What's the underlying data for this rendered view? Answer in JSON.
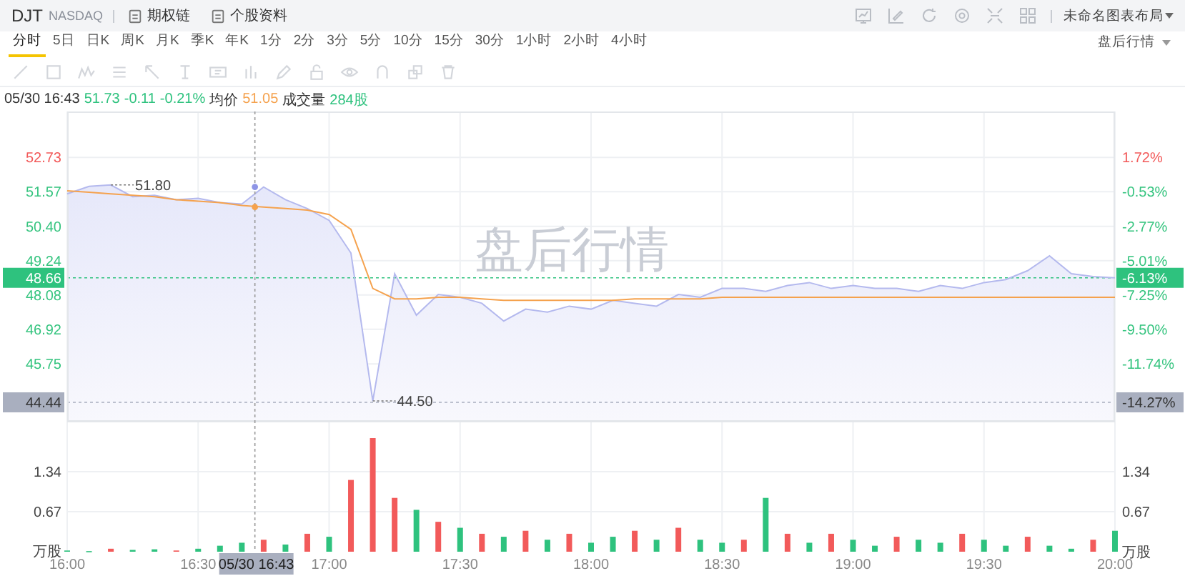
{
  "header": {
    "symbol": "DJT",
    "exchange": "NASDAQ",
    "links": [
      {
        "label": "期权链"
      },
      {
        "label": "个股资料"
      }
    ],
    "layout_menu": "未命名图表布局"
  },
  "periods": [
    {
      "label": "分时",
      "selected": true
    },
    {
      "label": "5日",
      "selected": false
    },
    {
      "label": "日K",
      "selected": false
    },
    {
      "label": "周K",
      "selected": false
    },
    {
      "label": "月K",
      "selected": false
    },
    {
      "label": "季K",
      "selected": false
    },
    {
      "label": "年K",
      "selected": false
    },
    {
      "label": "1分",
      "selected": false
    },
    {
      "label": "2分",
      "selected": false
    },
    {
      "label": "3分",
      "selected": false
    },
    {
      "label": "5分",
      "selected": false
    },
    {
      "label": "10分",
      "selected": false
    },
    {
      "label": "15分",
      "selected": false
    },
    {
      "label": "30分",
      "selected": false
    },
    {
      "label": "1小时",
      "selected": false
    },
    {
      "label": "2小时",
      "selected": false
    },
    {
      "label": "4小时",
      "selected": false
    }
  ],
  "session_menu": "盘后行情",
  "quote": {
    "time": "05/30 16:43",
    "price": "51.73",
    "change": "-0.11",
    "change_pct": "-0.21%",
    "avg_label": "均价",
    "avg": "51.05",
    "volume_label": "成交量",
    "volume": "284股"
  },
  "price_chart": {
    "watermark": "盘后行情",
    "left_axis_colors": [
      {
        "color": "#f25a5a"
      },
      {
        "color": "#35c47f"
      },
      {
        "color": "#35c47f"
      },
      {
        "color": "#35c47f"
      },
      {
        "color": "#35c47f"
      },
      {
        "color": "#35c47f"
      },
      {
        "color": "#35c47f"
      }
    ],
    "right_axis": [
      {
        "label": "1.72%",
        "color": "#f25a5a"
      },
      {
        "label": "-0.53%",
        "color": "#35c47f"
      },
      {
        "label": "-2.77%",
        "color": "#35c47f"
      },
      {
        "label": "-5.01%",
        "color": "#35c47f"
      },
      {
        "label": "-7.25%",
        "color": "#35c47f"
      },
      {
        "label": "-9.50%",
        "color": "#35c47f"
      },
      {
        "label": "-11.74%",
        "color": "#35c47f"
      }
    ],
    "current_tag": {
      "price": "48.66",
      "percent": "-6.13%"
    },
    "low_tag": {
      "price": "44.44",
      "percent": "-14.27%"
    },
    "chart_data": {
      "type": "line",
      "series": [
        {
          "color": "#b4b9ee",
          "values": [
            51.5,
            51.75,
            51.8,
            51.4,
            51.45,
            51.3,
            51.35,
            51.2,
            51.15,
            51.73,
            51.3,
            51.0,
            50.6,
            49.5,
            44.5,
            48.8,
            47.4,
            48.1,
            48.0,
            47.8,
            47.2,
            47.6,
            47.5,
            47.7,
            47.6,
            47.9,
            47.8,
            47.7,
            48.1,
            48.0,
            48.3,
            48.3,
            48.2,
            48.4,
            48.5,
            48.3,
            48.4,
            48.3,
            48.3,
            48.2,
            48.4,
            48.3,
            48.5,
            48.6,
            48.9,
            49.4,
            48.8,
            48.7,
            48.66
          ]
        },
        {
          "color": "#f5a24e",
          "values": [
            51.6,
            51.55,
            51.5,
            51.45,
            51.4,
            51.3,
            51.25,
            51.2,
            51.1,
            51.05,
            51.0,
            50.95,
            50.8,
            50.3,
            48.3,
            47.95,
            47.95,
            48.0,
            48.0,
            47.95,
            47.9,
            47.9,
            47.9,
            47.9,
            47.9,
            47.9,
            47.95,
            47.95,
            47.95,
            47.95,
            48.0,
            48.0,
            48.0,
            48.0,
            48.0,
            48.0,
            48.0,
            48.0,
            48.0,
            48.0,
            48.0,
            48.0,
            48.0,
            48.0,
            48.0,
            48.0,
            48.0,
            48.0,
            48.0
          ]
        }
      ],
      "ylim": [
        43.8,
        54.28
      ],
      "yticks": [
        {
          "value": 52.73,
          "label": "52.73"
        },
        {
          "value": 51.57,
          "label": "51.57"
        },
        {
          "value": 50.4,
          "label": "50.40"
        },
        {
          "value": 49.24,
          "label": "49.24"
        },
        {
          "value": 48.08,
          "label": "48.08"
        },
        {
          "value": 46.92,
          "label": "46.92"
        },
        {
          "value": 45.75,
          "label": "45.75"
        }
      ],
      "annotations": [
        "51.80",
        "44.50"
      ]
    }
  },
  "crosshair": {
    "time": "05/30 16:43"
  },
  "volume_chart": {
    "right_axis": [
      "1.34",
      "0.67",
      "万股"
    ],
    "chart_data": {
      "type": "bar",
      "ylabel": "万股",
      "categories": [
        "16:00",
        null,
        null,
        null,
        null,
        null,
        "16:30",
        null,
        null,
        null,
        null,
        null,
        "17:00",
        null,
        null,
        null,
        null,
        null,
        "17:30",
        null,
        null,
        null,
        null,
        null,
        "18:00",
        null,
        null,
        null,
        null,
        null,
        "18:30",
        null,
        null,
        null,
        null,
        null,
        "19:00",
        null,
        null,
        null,
        null,
        null,
        "19:30",
        null,
        null,
        null,
        null,
        null,
        "20:00"
      ],
      "ylim": [
        0,
        1.96
      ],
      "yticks": [
        {
          "value": 1.34,
          "label": "1.34"
        },
        {
          "value": 0.67,
          "label": "0.67"
        }
      ],
      "series": [
        {
          "color": "#f25a5a",
          "values": [
            null,
            null,
            0.05,
            null,
            null,
            0.02,
            null,
            null,
            null,
            0.2,
            null,
            0.3,
            null,
            1.2,
            1.9,
            0.9,
            null,
            0.5,
            null,
            0.3,
            null,
            0.35,
            null,
            0.3,
            null,
            null,
            0.35,
            null,
            0.4,
            null,
            null,
            0.2,
            null,
            0.3,
            null,
            0.3,
            null,
            null,
            0.25,
            null,
            null,
            0.3,
            null,
            null,
            0.25,
            null,
            null,
            0.2,
            null
          ]
        },
        {
          "color": "#2ec27e",
          "values": [
            0.02,
            0.01,
            null,
            0.03,
            0.04,
            null,
            0.05,
            0.1,
            0.15,
            null,
            0.12,
            null,
            0.25,
            null,
            null,
            null,
            0.7,
            null,
            0.4,
            null,
            0.25,
            null,
            0.2,
            null,
            0.15,
            0.25,
            null,
            0.2,
            null,
            0.2,
            0.15,
            null,
            0.9,
            null,
            0.15,
            null,
            0.2,
            0.1,
            null,
            0.2,
            0.15,
            null,
            0.2,
            0.1,
            null,
            0.1,
            0.05,
            null,
            0.35
          ]
        }
      ]
    }
  }
}
